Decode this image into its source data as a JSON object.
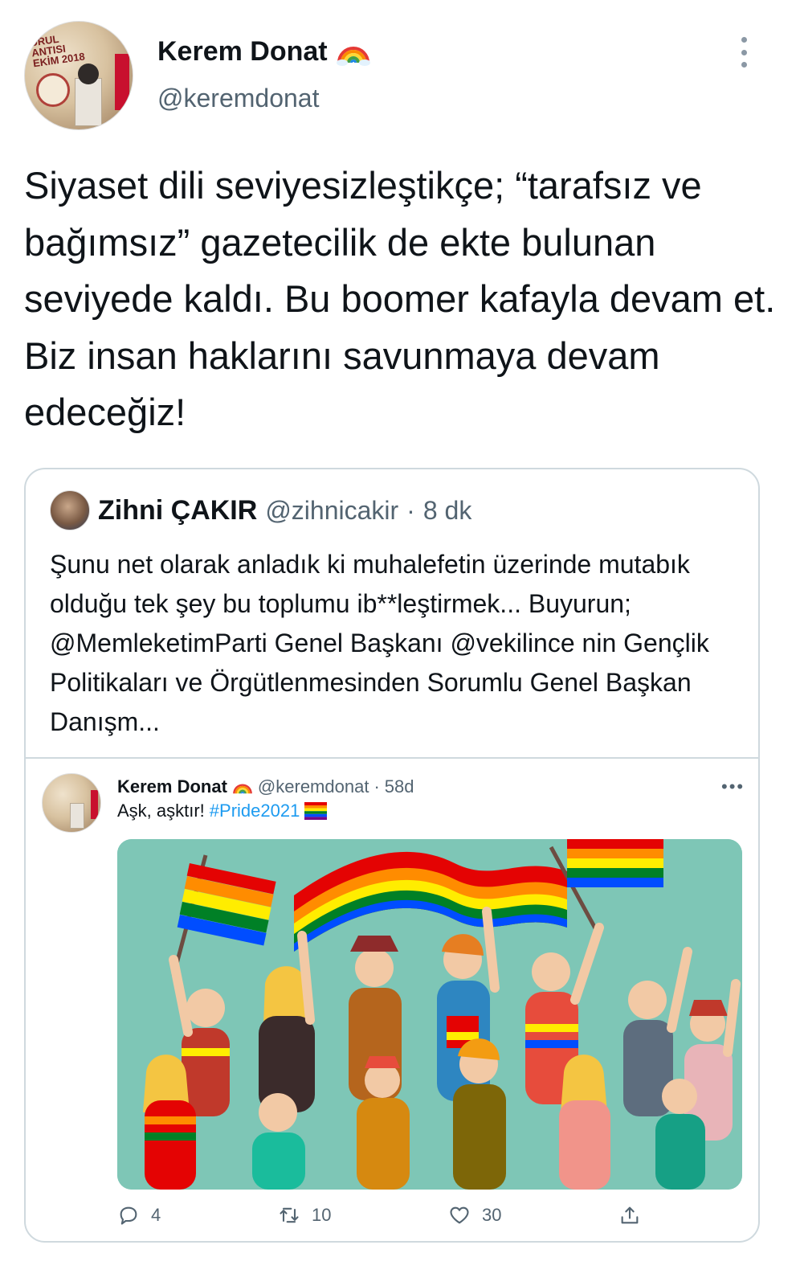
{
  "author": {
    "name": "Kerem Donat",
    "handle": "@keremdonat",
    "avatar_banner": "URUL\nANTISI\nEKİM 2018"
  },
  "tweet": {
    "text": "Siyaset dili seviyesizleştikçe; “tarafsız ve bağımsız” gazetecilik de ekte bulunan seviyede kaldı. Bu boomer kafayla devam et. Biz insan haklarını savunmaya devam edeceğiz!"
  },
  "quoted": {
    "name": "Zihni ÇAKIR",
    "handle": "@zihnicakir",
    "separator": "·",
    "time": "8 dk",
    "text": "Şunu net olarak anladık ki muhalefetin üzerinde mutabık olduğu tek şey bu toplumu ib**leştirmek... Buyurun; @MemleketimParti Genel Başkanı @vekilince nin Gençlik Politikaları ve Örgütlenmesinden Sorumlu Genel Başkan Danışm..."
  },
  "embedded": {
    "name": "Kerem Donat",
    "handle": "@keremdonat",
    "separator": "·",
    "time": "58d",
    "more": "•••",
    "text": "Aşk, aşktır!",
    "hashtag": "#Pride2021",
    "counts": {
      "replies": "4",
      "retweets": "10",
      "likes": "30"
    }
  },
  "icons": [
    "rainbow-icon",
    "more-icon",
    "reply-icon",
    "retweet-icon",
    "like-icon",
    "share-icon",
    "pride-flag-icon"
  ],
  "colors": {
    "text": "#0f1419",
    "muted": "#536471",
    "link": "#1d9bf0",
    "border": "#cfd9de",
    "illustration_bg": "#7ec6b6"
  }
}
